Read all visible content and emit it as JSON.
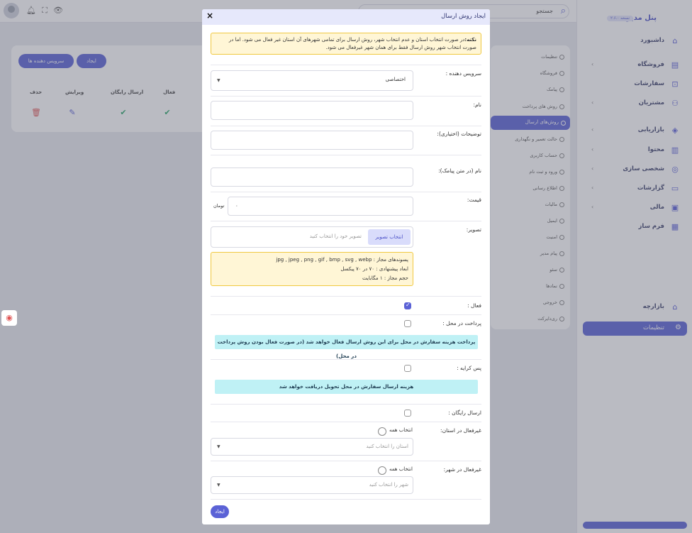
{
  "topbar": {
    "search_placeholder": "جستجو"
  },
  "sidebar": {
    "brand": "پنل مدیریت",
    "version": "نسخه ۲.۶.۰",
    "items": [
      {
        "label": "داشبورد",
        "icon": "home-icon",
        "chevron": false
      },
      {
        "label": "فروشگاه",
        "icon": "shop-icon",
        "chevron": true
      },
      {
        "label": "سفارشات",
        "icon": "cart-icon",
        "chevron": false
      },
      {
        "label": "مشتریان",
        "icon": "users-icon",
        "chevron": true
      },
      {
        "label": "بازاریابی",
        "icon": "megaphone-icon",
        "chevron": true
      },
      {
        "label": "محتوا",
        "icon": "document-icon",
        "chevron": true
      },
      {
        "label": "شخصی سازی",
        "icon": "globe-icon",
        "chevron": true
      },
      {
        "label": "گزارشات",
        "icon": "chart-icon",
        "chevron": true
      },
      {
        "label": "مالی",
        "icon": "wallet-icon",
        "chevron": true
      },
      {
        "label": "فرم ساز",
        "icon": "form-icon",
        "chevron": false
      },
      {
        "label": "بازارچه",
        "icon": "store-icon",
        "chevron": false
      }
    ],
    "active_item": "تنظیمات"
  },
  "settings_menu": [
    "تنظیمات",
    "فروشگاه",
    "پیامک",
    "روش های پرداخت",
    "روش‌های ارسال",
    "حالت تعمیر و نگهداری",
    "حساب کاربری",
    "ورود و ثبت نام",
    "اطلاع رسانی",
    "مالیات",
    "ایمیل",
    "امنیت",
    "پیام مدیر",
    "سئو",
    "نماد‌ها",
    "خروجی",
    "ری‌دایرکت"
  ],
  "settings_active_index": 4,
  "card": {
    "create_button": "ایجاد",
    "providers_button": "سرویس دهنده ها",
    "columns": [
      "حذف",
      "ویرایش",
      "ارسال رایگان",
      "فعال"
    ]
  },
  "modal": {
    "title": "ایجاد روش ارسال",
    "close": "×",
    "note_label": "نکته:",
    "note_text": "در صورت انتخاب استان و عدم انتخاب شهر، روش ارسال برای تمامی شهرهای آن استان غیر فعال می شود. اما در صورت انتخاب شهر روش ارسال فقط برای همان شهر غیرفعال می شود.",
    "provider_label": "سرویس دهنده :",
    "provider_value": "اختصاصی",
    "name_label": "نام:",
    "name_value": "",
    "description_label": "توضیحات (اختیاری):",
    "description_value": "",
    "sms_name_label": "نام (در متن پیامک):",
    "sms_name_value": "",
    "price_label": "قیمت:",
    "price_value": "۰",
    "price_unit": "تومان",
    "image_label": "تصویر:",
    "image_button": "انتخاب تصویر",
    "image_placeholder": "تصویر خود را انتخاب کنید",
    "image_info": [
      "پسوندهای مجاز : jpg , jpeg , png , gif , bmp , svg , webp",
      "ابعاد پیشنهادی : ۷۰ در ۷۰ پیکسل",
      "حجم مجاز : ۱ مگابایت"
    ],
    "active_label": "فعال :",
    "active_checked": true,
    "cod_label": "پرداخت در محل :",
    "cod_checked": false,
    "cod_info": "پرداخت هزینه سفارش در محل برای این روش ارسال فعال خواهد شد (در صورت فعال بودن روش پرداخت در محل)",
    "postpaid_label": "پس کرایه :",
    "postpaid_checked": false,
    "postpaid_info": "هزینه ارسال سفارش در محل تحویل دریافت خواهد شد",
    "free_label": "ارسال رایگان :",
    "free_checked": false,
    "disabled_province_label": "غیرفعال در استان:",
    "select_all_label": "انتخاب همه",
    "province_placeholder": "استان را انتخاب کنید",
    "disabled_city_label": "غیرفعال در شهر:",
    "city_placeholder": "شهر را انتخاب کنید",
    "submit": "ایجاد"
  }
}
